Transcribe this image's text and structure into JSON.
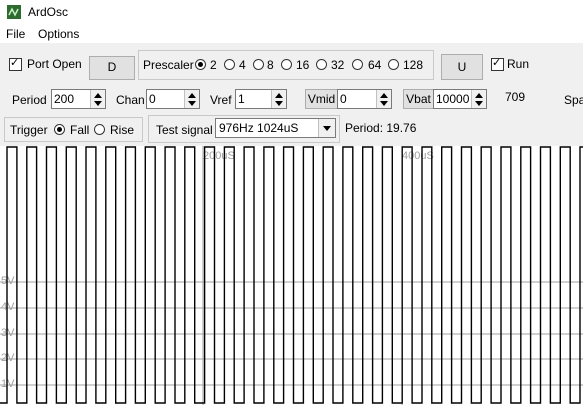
{
  "window": {
    "title": "ArdOsc"
  },
  "menu": {
    "items": [
      "File",
      "Options"
    ]
  },
  "controls": {
    "port_open": {
      "label": "Port Open",
      "checked": true
    },
    "d_button": "D",
    "prescaler": {
      "label": "Prescaler",
      "options": [
        "2",
        "4",
        "8",
        "16",
        "32",
        "64",
        "128"
      ],
      "selected": "2"
    },
    "u_button": "U",
    "run": {
      "label": "Run",
      "checked": true
    },
    "period": {
      "label": "Period",
      "value": "200"
    },
    "chan": {
      "label": "Chan",
      "value": "0"
    },
    "vref": {
      "label": "Vref",
      "value": "1"
    },
    "vmid": {
      "label": "Vmid",
      "value": "0"
    },
    "vbat": {
      "label": "Vbat",
      "value": "10000"
    },
    "readout": "709",
    "cut_label": "Spa",
    "trigger": {
      "label": "Trigger",
      "options": [
        "Fall",
        "Rise"
      ],
      "selected": "Fall"
    },
    "test_signal": {
      "label": "Test signal",
      "value": "976Hz 1024uS"
    },
    "period_readout": "Period: 19.76"
  },
  "scope": {
    "time_labels": [
      "200uS",
      "400uS"
    ],
    "volt_labels": [
      "5V",
      "4V",
      "3V",
      "2V",
      "1V"
    ],
    "colors": {
      "trace": "#000000",
      "grid": "#a0a0a0",
      "bg": "#ffffff"
    }
  }
}
